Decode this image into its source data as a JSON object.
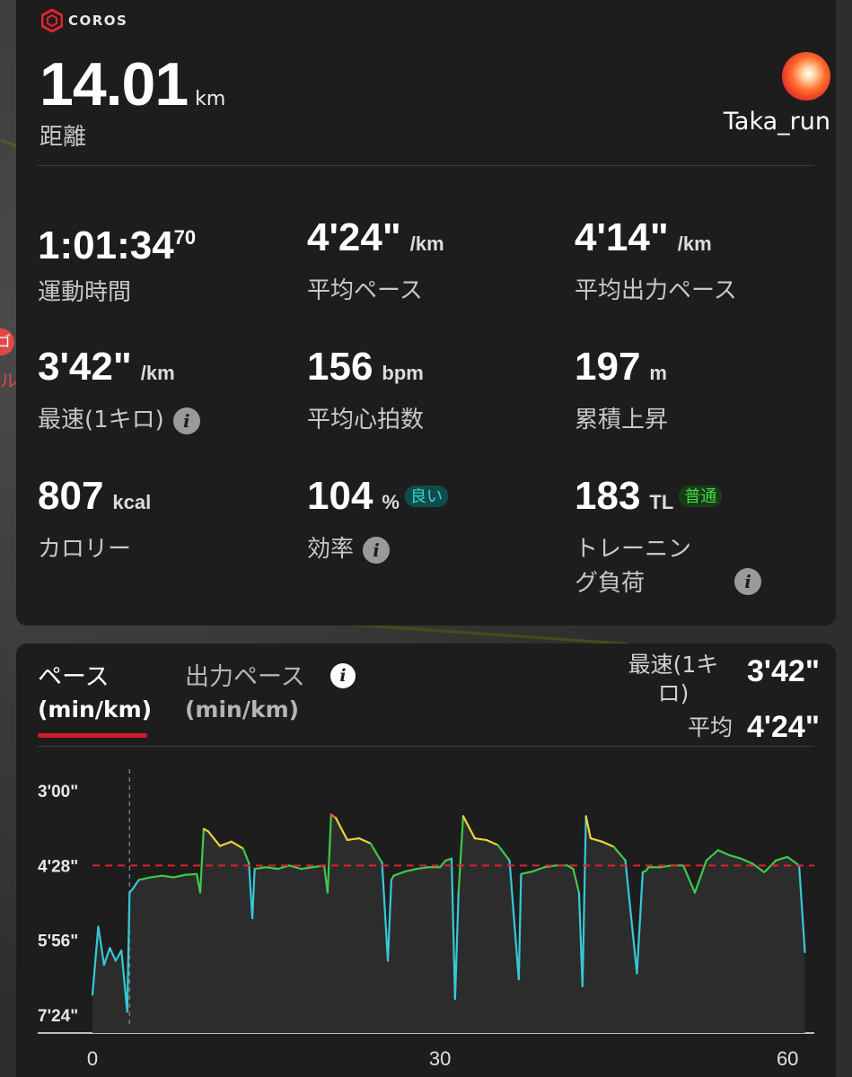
{
  "app": {
    "brand": "COROS"
  },
  "header": {
    "distance_value": "14.01",
    "distance_unit": "km",
    "distance_label": "距離",
    "username": "Taka_run"
  },
  "metrics": [
    {
      "value": "1:01:34",
      "value_sup": "70",
      "unit": "",
      "label": "運動時間"
    },
    {
      "value": "4'24\"",
      "unit": "/km",
      "label": "平均ペース"
    },
    {
      "value": "4'14\"",
      "unit": "/km",
      "label": "平均出力ペース"
    },
    {
      "value": "3'42\"",
      "unit": "/km",
      "label": "最速(1キロ)",
      "info": "i"
    },
    {
      "value": "156",
      "unit": "bpm",
      "label": "平均心拍数"
    },
    {
      "value": "197",
      "unit": "m",
      "label": "累積上昇"
    },
    {
      "value": "807",
      "unit": "kcal",
      "label": "カロリー"
    },
    {
      "value": "104",
      "unit": "%",
      "badge": "良い",
      "label": "効率",
      "info": "i"
    },
    {
      "value": "183",
      "unit": "TL",
      "badge": "普通",
      "label_line1": "トレーニン",
      "label_line2": "グ負荷",
      "info": "i"
    }
  ],
  "chart_panel": {
    "tab_pace": "ペース",
    "tab_pace_unit": "(min/km)",
    "tab_power": "出力ペース",
    "tab_power_unit": "(min/km)",
    "tab_info": "i",
    "fastest_label_1": "最速(1キ",
    "fastest_label_2": "ロ)",
    "fastest_value": "3'42\"",
    "avg_label": "平均",
    "avg_value": "4'24\""
  },
  "chart_data": {
    "type": "line",
    "x_label": "",
    "y_label": "",
    "y_ticks": [
      "3'00\"",
      "4'28\"",
      "5'56\"",
      "7'24\""
    ],
    "x_ticks": [
      "0",
      "30",
      "60"
    ],
    "xlim": [
      0,
      62
    ],
    "ylim_sec_per_km": [
      180,
      444
    ],
    "avg_line_sec_per_km": 268,
    "colors": {
      "fast": "#ff5a3c",
      "tempo": "#f2d23a",
      "steady": "#3fc94a",
      "easy": "#36c9d6",
      "avg": "#e02030"
    },
    "x": [
      0,
      0.5,
      1,
      1.5,
      2,
      2.5,
      3,
      3.2,
      3.5,
      4,
      5,
      6,
      7,
      8,
      9,
      9.3,
      9.6,
      10,
      11,
      12,
      13,
      13.5,
      13.8,
      14,
      15,
      16,
      17,
      18,
      19,
      20,
      20.3,
      20.6,
      21,
      22,
      23,
      24,
      25,
      25.5,
      25.8,
      26,
      27,
      28,
      29,
      30,
      30.5,
      31,
      31.3,
      31.6,
      32,
      33,
      34,
      35,
      36,
      36.8,
      37,
      38,
      39,
      40,
      41,
      41.5,
      42,
      42.3,
      42.6,
      43,
      44,
      45,
      46,
      47,
      47.5,
      47.8,
      48,
      49,
      50,
      51,
      52,
      53,
      54,
      55,
      56,
      57,
      58,
      59,
      60,
      61,
      61.5
    ],
    "y": [
      420,
      340,
      385,
      365,
      380,
      368,
      440,
      300,
      295,
      285,
      282,
      280,
      282,
      279,
      278,
      300,
      225,
      228,
      245,
      240,
      248,
      265,
      330,
      272,
      270,
      272,
      268,
      272,
      270,
      268,
      300,
      208,
      212,
      238,
      236,
      242,
      265,
      380,
      285,
      280,
      275,
      272,
      270,
      270,
      262,
      260,
      425,
      300,
      210,
      236,
      238,
      244,
      262,
      402,
      278,
      275,
      270,
      268,
      268,
      272,
      300,
      410,
      210,
      236,
      240,
      246,
      262,
      395,
      276,
      274,
      270,
      270,
      268,
      268,
      300,
      262,
      250,
      256,
      260,
      266,
      276,
      262,
      258,
      268,
      370
    ]
  }
}
